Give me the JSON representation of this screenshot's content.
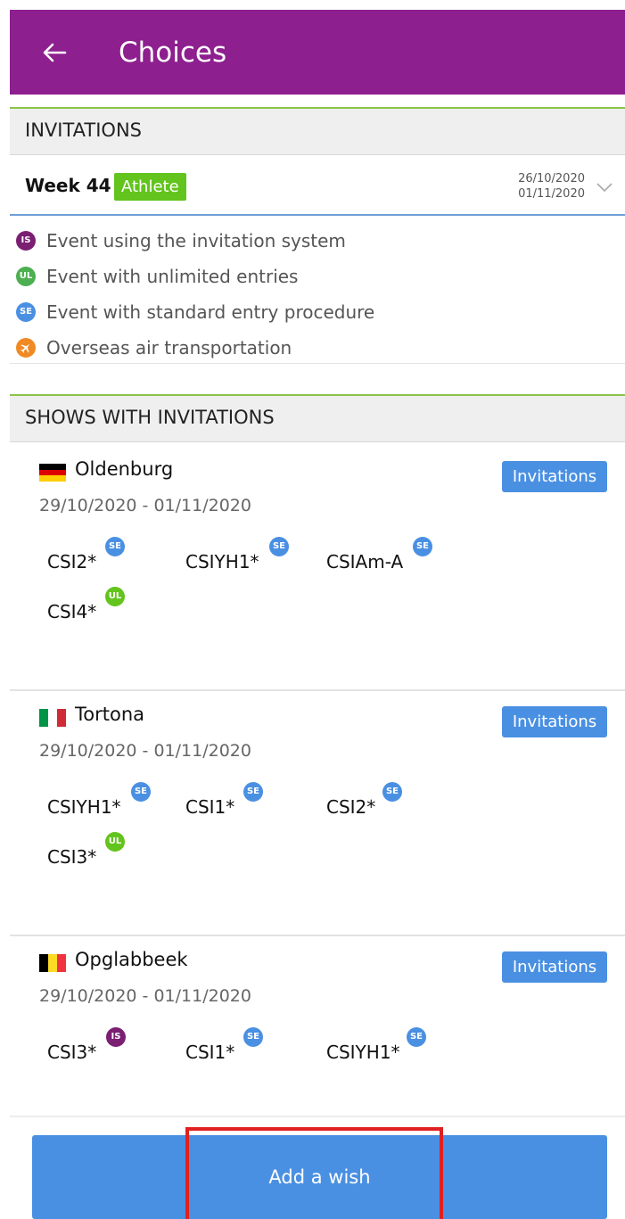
{
  "appbar": {
    "title": "Choices",
    "back_icon": "arrow-left-icon"
  },
  "invitations_header": "INVITATIONS",
  "week": {
    "label": "Week 44",
    "role_badge": "Athlete",
    "start_date": "26/10/2020",
    "end_date": "01/11/2020",
    "expand_icon": "chevron-down-icon"
  },
  "legend": [
    {
      "code": "IS",
      "color": "#7b1f73",
      "label": "Event using the invitation system"
    },
    {
      "code": "UL",
      "color": "#4caf50",
      "label": "Event with unlimited entries"
    },
    {
      "code": "SE",
      "color": "#4a90e2",
      "label": "Event with standard entry procedure"
    },
    {
      "code": "✈",
      "color": "#f08a24",
      "label": "Overseas air transportation",
      "icon": "airplane-icon"
    }
  ],
  "shows_header": "SHOWS WITH INVITATIONS",
  "shows": [
    {
      "name": "Oldenburg",
      "country_flag": "germany-flag",
      "dates": "29/10/2020 - 01/11/2020",
      "invitations_label": "Invitations",
      "classes": [
        {
          "name": "CSI2*",
          "badge": "SE"
        },
        {
          "name": "CSIYH1*",
          "badge": "SE"
        },
        {
          "name": "CSIAm-A",
          "badge": "SE"
        },
        {
          "name": "CSI4*",
          "badge": "UL"
        }
      ]
    },
    {
      "name": "Tortona",
      "country_flag": "italy-flag",
      "dates": "29/10/2020 - 01/11/2020",
      "invitations_label": "Invitations",
      "classes": [
        {
          "name": "CSIYH1*",
          "badge": "SE"
        },
        {
          "name": "CSI1*",
          "badge": "SE"
        },
        {
          "name": "CSI2*",
          "badge": "SE"
        },
        {
          "name": "CSI3*",
          "badge": "UL"
        }
      ]
    },
    {
      "name": "Opglabbeek",
      "country_flag": "belgium-flag",
      "dates": "29/10/2020 - 01/11/2020",
      "invitations_label": "Invitations",
      "classes": [
        {
          "name": "CSI3*",
          "badge": "IS"
        },
        {
          "name": "CSI1*",
          "badge": "SE"
        },
        {
          "name": "CSIYH1*",
          "badge": "SE"
        }
      ]
    }
  ],
  "add_wish_label": "Add a wish",
  "colors": {
    "appbar": "#8e1f8f",
    "accent_line": "#8bc34a",
    "primary_button": "#4a90e2",
    "athlete_badge": "#62c41c",
    "highlight_box": "#e02020"
  }
}
